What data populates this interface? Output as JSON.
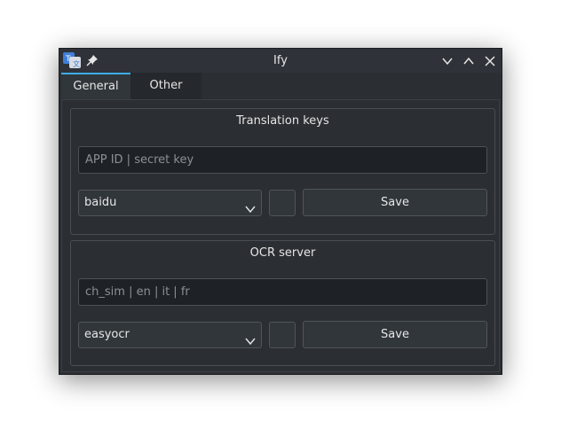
{
  "window": {
    "title": "Ify",
    "icons": {
      "app": "translate-app-icon",
      "pin": "pin-icon",
      "minimize": "chevron-down-icon",
      "maximize": "chevron-up-icon",
      "close": "close-icon"
    }
  },
  "tabs": [
    {
      "label": "General",
      "active": true
    },
    {
      "label": "Other",
      "active": false
    }
  ],
  "translation": {
    "title": "Translation keys",
    "input_placeholder": "APP ID | secret key",
    "engine": "baidu",
    "save_label": "Save"
  },
  "ocr": {
    "title": "OCR server",
    "input_placeholder": "ch_sim | en | it | fr",
    "engine": "easyocr",
    "save_label": "Save"
  },
  "colors": {
    "accent": "#3daee9",
    "window_bg": "#2b2e33",
    "text": "#e6e6e6"
  }
}
